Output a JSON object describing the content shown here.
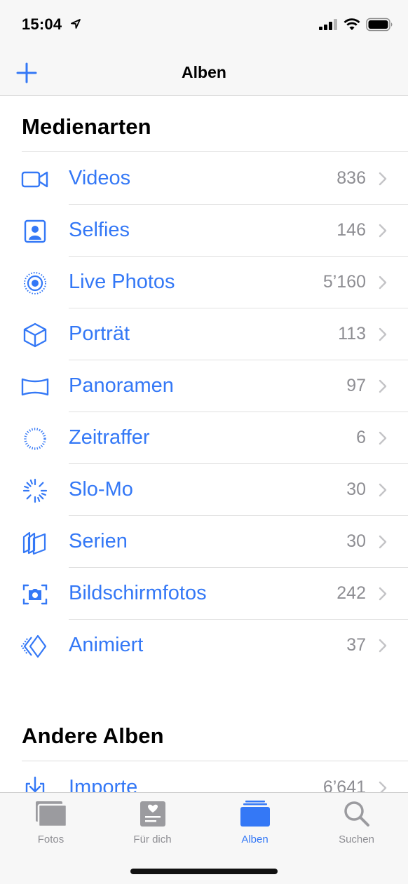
{
  "status": {
    "time": "15:04"
  },
  "nav": {
    "title": "Alben"
  },
  "sections": [
    {
      "title": "Medienarten"
    },
    {
      "title": "Andere Alben"
    }
  ],
  "media_types": [
    {
      "icon": "video-camera-icon",
      "label": "Videos",
      "count": "836"
    },
    {
      "icon": "selfie-portrait-icon",
      "label": "Selfies",
      "count": "146"
    },
    {
      "icon": "live-photo-icon",
      "label": "Live Photos",
      "count": "5’160"
    },
    {
      "icon": "portrait-cube-icon",
      "label": "Porträt",
      "count": "113"
    },
    {
      "icon": "panorama-icon",
      "label": "Panoramen",
      "count": "97"
    },
    {
      "icon": "timelapse-icon",
      "label": "Zeitraffer",
      "count": "6"
    },
    {
      "icon": "slo-mo-icon",
      "label": "Slo-Mo",
      "count": "30"
    },
    {
      "icon": "burst-stack-icon",
      "label": "Serien",
      "count": "30"
    },
    {
      "icon": "screenshot-camera-icon",
      "label": "Bildschirmfotos",
      "count": "242"
    },
    {
      "icon": "animated-icon",
      "label": "Animiert",
      "count": "37"
    }
  ],
  "other_albums": [
    {
      "icon": "import-tray-icon",
      "label": "Importe",
      "count": "6’641"
    }
  ],
  "tabs": [
    {
      "icon": "photos-stack-icon",
      "label": "Fotos",
      "active": false
    },
    {
      "icon": "for-you-heart-icon",
      "label": "Für dich",
      "active": false
    },
    {
      "icon": "albums-icon",
      "label": "Alben",
      "active": true
    },
    {
      "icon": "search-icon",
      "label": "Suchen",
      "active": false
    }
  ],
  "colors": {
    "accent": "#3478f6",
    "secondary_text": "#8e8e93",
    "bar_background": "#f7f7f7"
  }
}
